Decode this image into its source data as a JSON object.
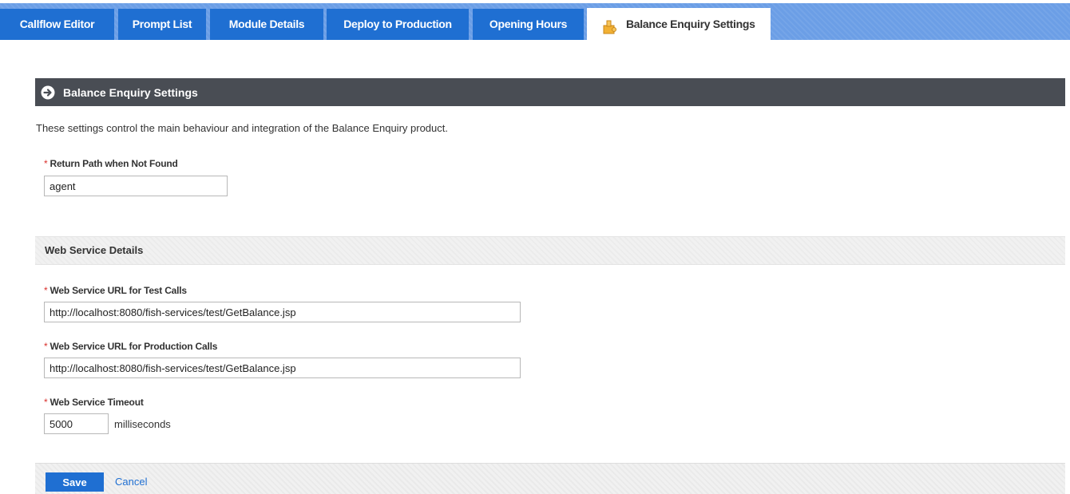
{
  "tabs": [
    {
      "label": "Callflow Editor",
      "active": false
    },
    {
      "label": "Prompt List",
      "active": false
    },
    {
      "label": "Module Details",
      "active": false
    },
    {
      "label": "Deploy to Production",
      "active": false
    },
    {
      "label": "Opening Hours",
      "active": false
    },
    {
      "label": "Balance Enquiry Settings",
      "active": true,
      "icon": "puzzle-icon"
    }
  ],
  "panel": {
    "title": "Balance Enquiry Settings",
    "title_icon": "arrow-circle-icon",
    "description": "These settings control the main behaviour and integration of the Balance Enquiry product."
  },
  "fields": {
    "required_marker": "*",
    "return_path": {
      "label": "Return Path when Not Found",
      "value": "agent"
    },
    "test_url": {
      "label": "Web Service URL for Test Calls",
      "value": "http://localhost:8080/fish-services/test/GetBalance.jsp"
    },
    "prod_url": {
      "label": "Web Service URL for Production Calls",
      "value": "http://localhost:8080/fish-services/test/GetBalance.jsp"
    },
    "timeout": {
      "label": "Web Service Timeout",
      "value": "5000",
      "unit": "milliseconds"
    }
  },
  "section": {
    "title": "Web Service Details"
  },
  "footer": {
    "save_label": "Save",
    "cancel_label": "Cancel"
  },
  "colors": {
    "tab_blue": "#1f6fd2",
    "tab_bar": "#6b9ee6",
    "title_bar": "#494d54",
    "required": "#d9302c"
  }
}
